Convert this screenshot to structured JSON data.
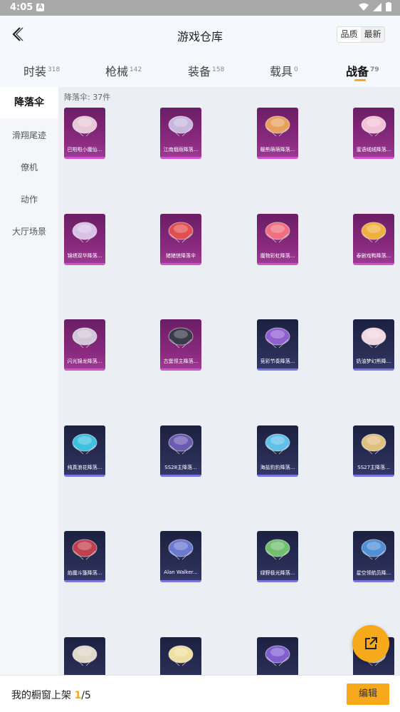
{
  "status": {
    "time": "4:05",
    "notif_glyph": "A"
  },
  "header": {
    "title": "游戏仓库",
    "sort_quality": "品质",
    "sort_newest": "最新"
  },
  "tabs": [
    {
      "label": "时装",
      "count": "318"
    },
    {
      "label": "枪械",
      "count": "142"
    },
    {
      "label": "装备",
      "count": "158"
    },
    {
      "label": "载具",
      "count": "0"
    },
    {
      "label": "战备",
      "count": "79"
    }
  ],
  "sidebar": [
    "降落伞",
    "滑翔尾迹",
    "僚机",
    "动作",
    "大厅场景"
  ],
  "content": {
    "count_label": "降落伞: 37件"
  },
  "items": [
    {
      "name": "巴啦啦小魔仙...",
      "rarity": "purple",
      "color": "#e8c9d8"
    },
    {
      "name": "江南烟雨降落...",
      "rarity": "purple",
      "color": "#c8b8e0"
    },
    {
      "name": "暖熊萌萌降落...",
      "rarity": "purple",
      "color": "#e8a060"
    },
    {
      "name": "蜜语绒绒降落...",
      "rarity": "purple",
      "color": "#f2c2d8"
    },
    {
      "name": "锦绣双华降落...",
      "rarity": "purple",
      "color": "#d8c2e8"
    },
    {
      "name": "猪猪侠降落伞",
      "rarity": "purple",
      "color": "#e05050"
    },
    {
      "name": "魔物彩虹降落...",
      "rarity": "purple",
      "color": "#f07080"
    },
    {
      "name": "泰剧戏鸭降落...",
      "rarity": "purple",
      "color": "#f0b040"
    },
    {
      "name": "闪光锦龙降落...",
      "rarity": "purple",
      "color": "#d0c8d8"
    },
    {
      "name": "古堡领主降落...",
      "rarity": "purple",
      "color": "#3a3a4a"
    },
    {
      "name": "竞彩节奏降落...",
      "rarity": "blue",
      "color": "#9060d0"
    },
    {
      "name": "奶油梦幻熊降...",
      "rarity": "blue",
      "color": "#f0d8e0"
    },
    {
      "name": "纯真浪花降落...",
      "rarity": "blue",
      "color": "#40c0e0"
    },
    {
      "name": "SS28主降落...",
      "rarity": "blue",
      "color": "#6a5ab0"
    },
    {
      "name": "海盐豹豹降落...",
      "rarity": "blue",
      "color": "#60c0e8"
    },
    {
      "name": "SS27主降落...",
      "rarity": "blue",
      "color": "#e0c080"
    },
    {
      "name": "焰魔斗篷降落...",
      "rarity": "blue",
      "color": "#c04050"
    },
    {
      "name": "Alan Walker...",
      "rarity": "blue",
      "color": "#6a7ad0"
    },
    {
      "name": "绿野极光降落...",
      "rarity": "blue",
      "color": "#70c070"
    },
    {
      "name": "星空领航员降...",
      "rarity": "blue",
      "color": "#5090d8"
    },
    {
      "name": "",
      "rarity": "blue",
      "color": "#e0d8c8"
    },
    {
      "name": "",
      "rarity": "blue",
      "color": "#f0e0a0"
    },
    {
      "name": "",
      "rarity": "blue",
      "color": "#8060d0"
    },
    {
      "name": "",
      "rarity": "blue",
      "color": "#d8d8e0"
    }
  ],
  "bottom": {
    "label": "我的橱窗上架",
    "current": "1",
    "total": "/5",
    "edit": "编辑"
  }
}
